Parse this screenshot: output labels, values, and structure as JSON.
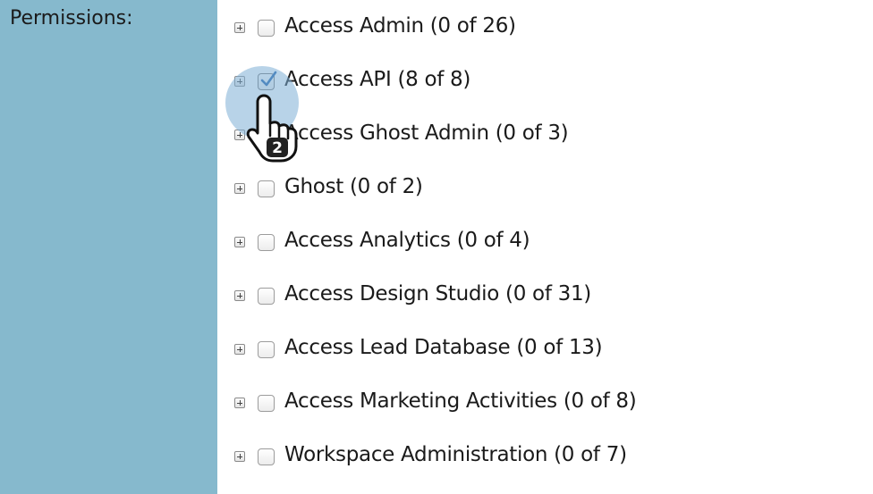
{
  "sidebar": {
    "label": "Permissions:"
  },
  "permissions": [
    {
      "label": "Access Admin (0 of 26)",
      "checked": false
    },
    {
      "label": "Access API (8 of 8)",
      "checked": true
    },
    {
      "label": "Access Ghost Admin (0 of 3)",
      "checked": false
    },
    {
      "label": "Ghost (0 of 2)",
      "checked": false
    },
    {
      "label": "Access Analytics (0 of 4)",
      "checked": false
    },
    {
      "label": "Access Design Studio (0 of 31)",
      "checked": false
    },
    {
      "label": "Access Lead Database (0 of 13)",
      "checked": false
    },
    {
      "label": "Access Marketing Activities (0 of 8)",
      "checked": false
    },
    {
      "label": "Workspace Administration (0 of 7)",
      "checked": false
    }
  ],
  "cursor": {
    "badge": "2"
  },
  "colors": {
    "sidebar_bg": "#86b9cd",
    "halo": "#7eafd6",
    "check_mark": "#1f5fa8"
  }
}
